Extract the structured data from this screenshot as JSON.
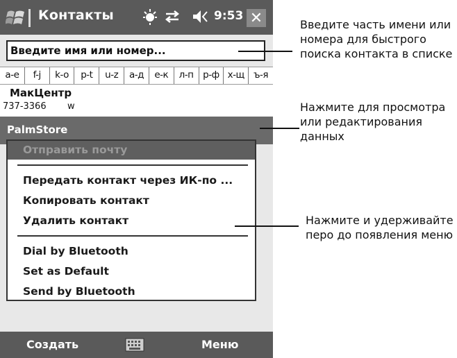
{
  "window": {
    "title": "Контакты",
    "time": "9:53",
    "close_label": "✕"
  },
  "search": {
    "placeholder": "Введите имя или номер..."
  },
  "alphabet": [
    "а-е",
    "f-j",
    "k-o",
    "p-t",
    "u-z",
    "а-д",
    "е-к",
    "л-п",
    "р-ф",
    "х-щ",
    "ъ-я"
  ],
  "contacts": [
    {
      "name": "МакЦентр",
      "phone": "737-3366",
      "type": "w"
    },
    {
      "name": "PalmStore"
    }
  ],
  "context_menu": {
    "items": [
      {
        "label": "Отправить почту",
        "enabled": false
      },
      {
        "label": "Передать контакт через ИК-по ..."
      },
      {
        "label": "Копировать контакт"
      },
      {
        "label": "Удалить контакт"
      },
      {
        "label": "Dial by Bluetooth"
      },
      {
        "label": "Set as Default"
      },
      {
        "label": "Send by Bluetooth"
      }
    ]
  },
  "bottom_bar": {
    "left": "Создать",
    "right": "Меню"
  },
  "callouts": [
    "Введите часть имени или номера для быстрого поиска контакта в списке",
    "Нажмите для просмотра или редактирования данных",
    "Нажмите и удерживайте перо до появления меню"
  ],
  "icons": [
    "windows-start-icon",
    "notification-icon",
    "connectivity-icon",
    "volume-icon",
    "keyboard-icon"
  ]
}
